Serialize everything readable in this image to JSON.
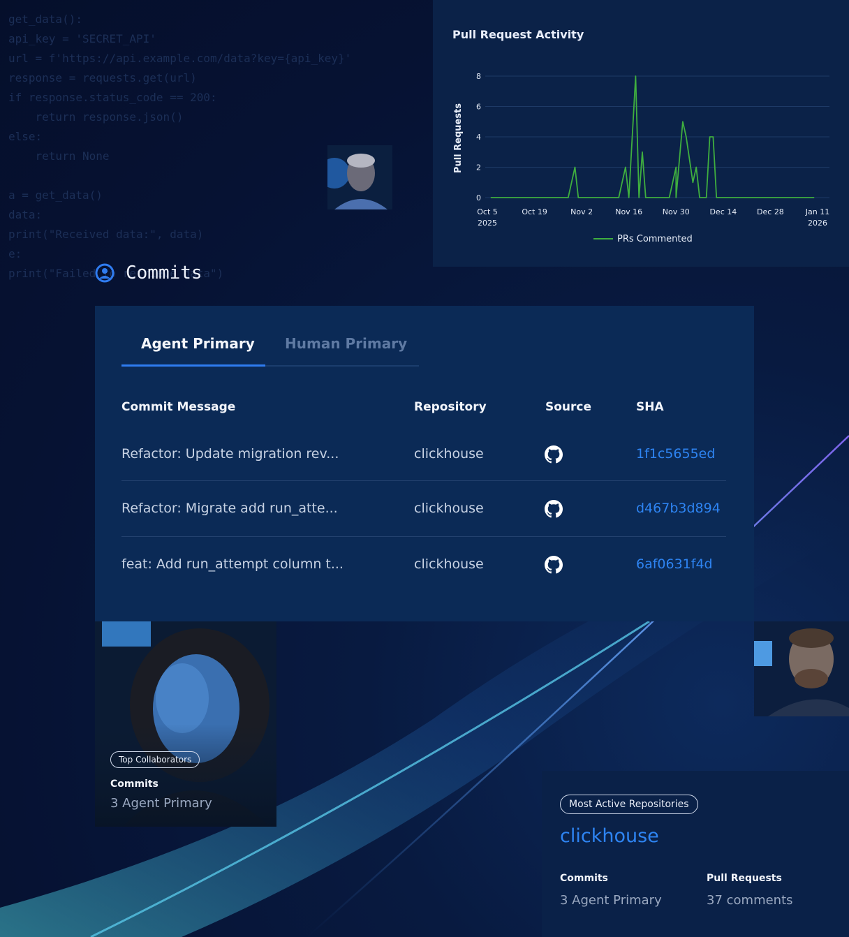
{
  "background": {
    "code_lines": [
      "get_data():",
      "api_key = 'SECRET_API'",
      "url = f'https://api.example.com/data?key={api_key}'",
      "response = requests.get(url)",
      "if response.status_code == 200:",
      "    return response.json()",
      "else:",
      "    return None",
      "",
      "a = get_data()",
      "data:",
      "print(\"Received data:\", data)",
      "e:",
      "print(\"Failed to retrieve data\")"
    ]
  },
  "chart": {
    "title": "Pull Request Activity"
  },
  "chart_data": {
    "type": "line",
    "title": "Pull Request Activity",
    "xlabel": "",
    "ylabel": "Pull Requests",
    "ylim": [
      0,
      8
    ],
    "yticks": [
      0,
      2,
      4,
      6,
      8
    ],
    "xticks": [
      {
        "line1": "Oct 5",
        "line2": "2025"
      },
      {
        "line1": "Oct 19",
        "line2": ""
      },
      {
        "line1": "Nov 2",
        "line2": ""
      },
      {
        "line1": "Nov 16",
        "line2": ""
      },
      {
        "line1": "Nov 30",
        "line2": ""
      },
      {
        "line1": "Dec 14",
        "line2": ""
      },
      {
        "line1": "Dec 28",
        "line2": ""
      },
      {
        "line1": "Jan 11",
        "line2": "2026"
      }
    ],
    "grid": true,
    "legend_position": "bottom",
    "series": [
      {
        "name": "PRs Commented",
        "color": "#3fae3f",
        "points": [
          [
            "2025-10-06",
            0
          ],
          [
            "2025-10-29",
            0
          ],
          [
            "2025-10-31",
            2
          ],
          [
            "2025-11-01",
            0
          ],
          [
            "2025-11-13",
            0
          ],
          [
            "2025-11-15",
            2
          ],
          [
            "2025-11-16",
            0
          ],
          [
            "2025-11-18",
            8
          ],
          [
            "2025-11-19",
            0
          ],
          [
            "2025-11-20",
            3
          ],
          [
            "2025-11-21",
            0
          ],
          [
            "2025-11-28",
            0
          ],
          [
            "2025-11-30",
            2
          ],
          [
            "2025-11-30",
            0
          ],
          [
            "2025-12-02",
            5
          ],
          [
            "2025-12-03",
            4
          ],
          [
            "2025-12-05",
            1
          ],
          [
            "2025-12-06",
            2
          ],
          [
            "2025-12-07",
            0
          ],
          [
            "2025-12-09",
            0
          ],
          [
            "2025-12-10",
            4
          ],
          [
            "2025-12-11",
            4
          ],
          [
            "2025-12-12",
            0
          ],
          [
            "2026-01-10",
            0
          ]
        ]
      }
    ]
  },
  "commits": {
    "heading": "Commits",
    "tabs": [
      {
        "label": "Agent Primary",
        "active": true
      },
      {
        "label": "Human Primary",
        "active": false
      }
    ],
    "columns": {
      "message": "Commit Message",
      "repository": "Repository",
      "source": "Source",
      "sha": "SHA"
    },
    "rows": [
      {
        "message": "Refactor: Update migration rev...",
        "repository": "clickhouse",
        "source_icon": "github-icon",
        "sha": "1f1c5655ed"
      },
      {
        "message": "Refactor: Migrate add run_atte...",
        "repository": "clickhouse",
        "source_icon": "github-icon",
        "sha": "d467b3d894"
      },
      {
        "message": "feat: Add run_attempt column t...",
        "repository": "clickhouse",
        "source_icon": "github-icon",
        "sha": "6af0631f4d"
      }
    ]
  },
  "collaborators": {
    "badge": "Top Collaborators",
    "label": "Commits",
    "value": "3 Agent Primary"
  },
  "repositories": {
    "badge": "Most Active Repositories",
    "name": "clickhouse",
    "stats": [
      {
        "label": "Commits",
        "value": "3 Agent Primary"
      },
      {
        "label": "Pull Requests",
        "value": "37 comments"
      }
    ]
  },
  "colors": {
    "accent": "#2e84f2",
    "line": "#3fae3f",
    "panel": "#0b2a56"
  }
}
